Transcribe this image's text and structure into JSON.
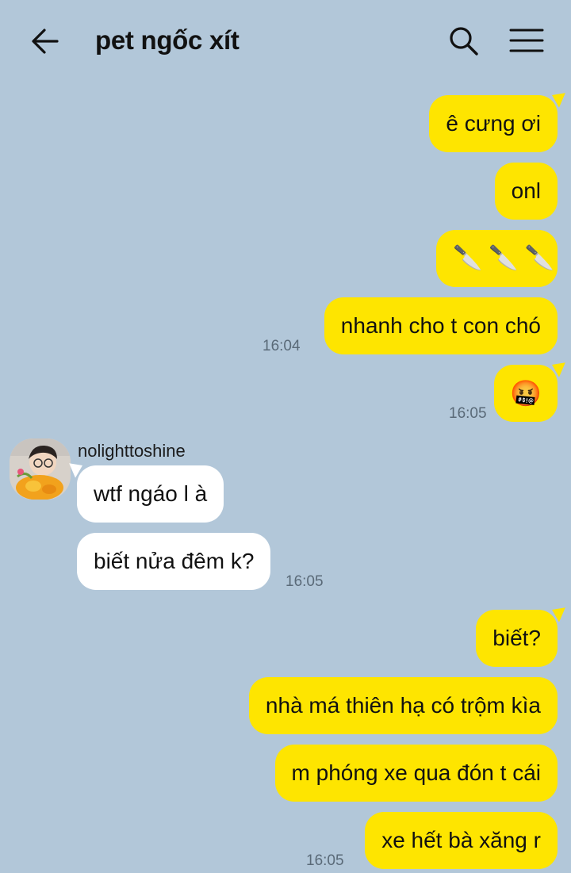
{
  "header": {
    "title": "pet ngốc xít"
  },
  "icons": {
    "back": "arrow-left-icon",
    "search": "search-icon",
    "menu": "hamburger-menu-icon"
  },
  "colors": {
    "background": "#b2c7d9",
    "outgoing_bubble": "#fee500",
    "incoming_bubble": "#ffffff"
  },
  "messages": [
    {
      "direction": "out",
      "text": "ê cưng ơi"
    },
    {
      "direction": "out",
      "text": "onl"
    },
    {
      "direction": "out",
      "type": "emoji",
      "emoji": [
        "🔪",
        "🔪",
        "🔪"
      ]
    },
    {
      "direction": "out",
      "text": "nhanh cho t con chó",
      "time": "16:04"
    },
    {
      "direction": "out",
      "type": "emoji",
      "emoji": [
        "🤬"
      ],
      "time": "16:05"
    },
    {
      "direction": "in",
      "sender": "nolighttoshine",
      "text": "wtf ngáo l à"
    },
    {
      "direction": "in",
      "text": "biết nửa đêm k?",
      "time": "16:05"
    },
    {
      "direction": "out",
      "text": "biết?"
    },
    {
      "direction": "out",
      "text": "nhà má thiên hạ có trộm kìa"
    },
    {
      "direction": "out",
      "text": "m phóng xe qua đón t cái"
    },
    {
      "direction": "out",
      "text": "xe hết bà xăng r",
      "time": "16:05"
    }
  ]
}
